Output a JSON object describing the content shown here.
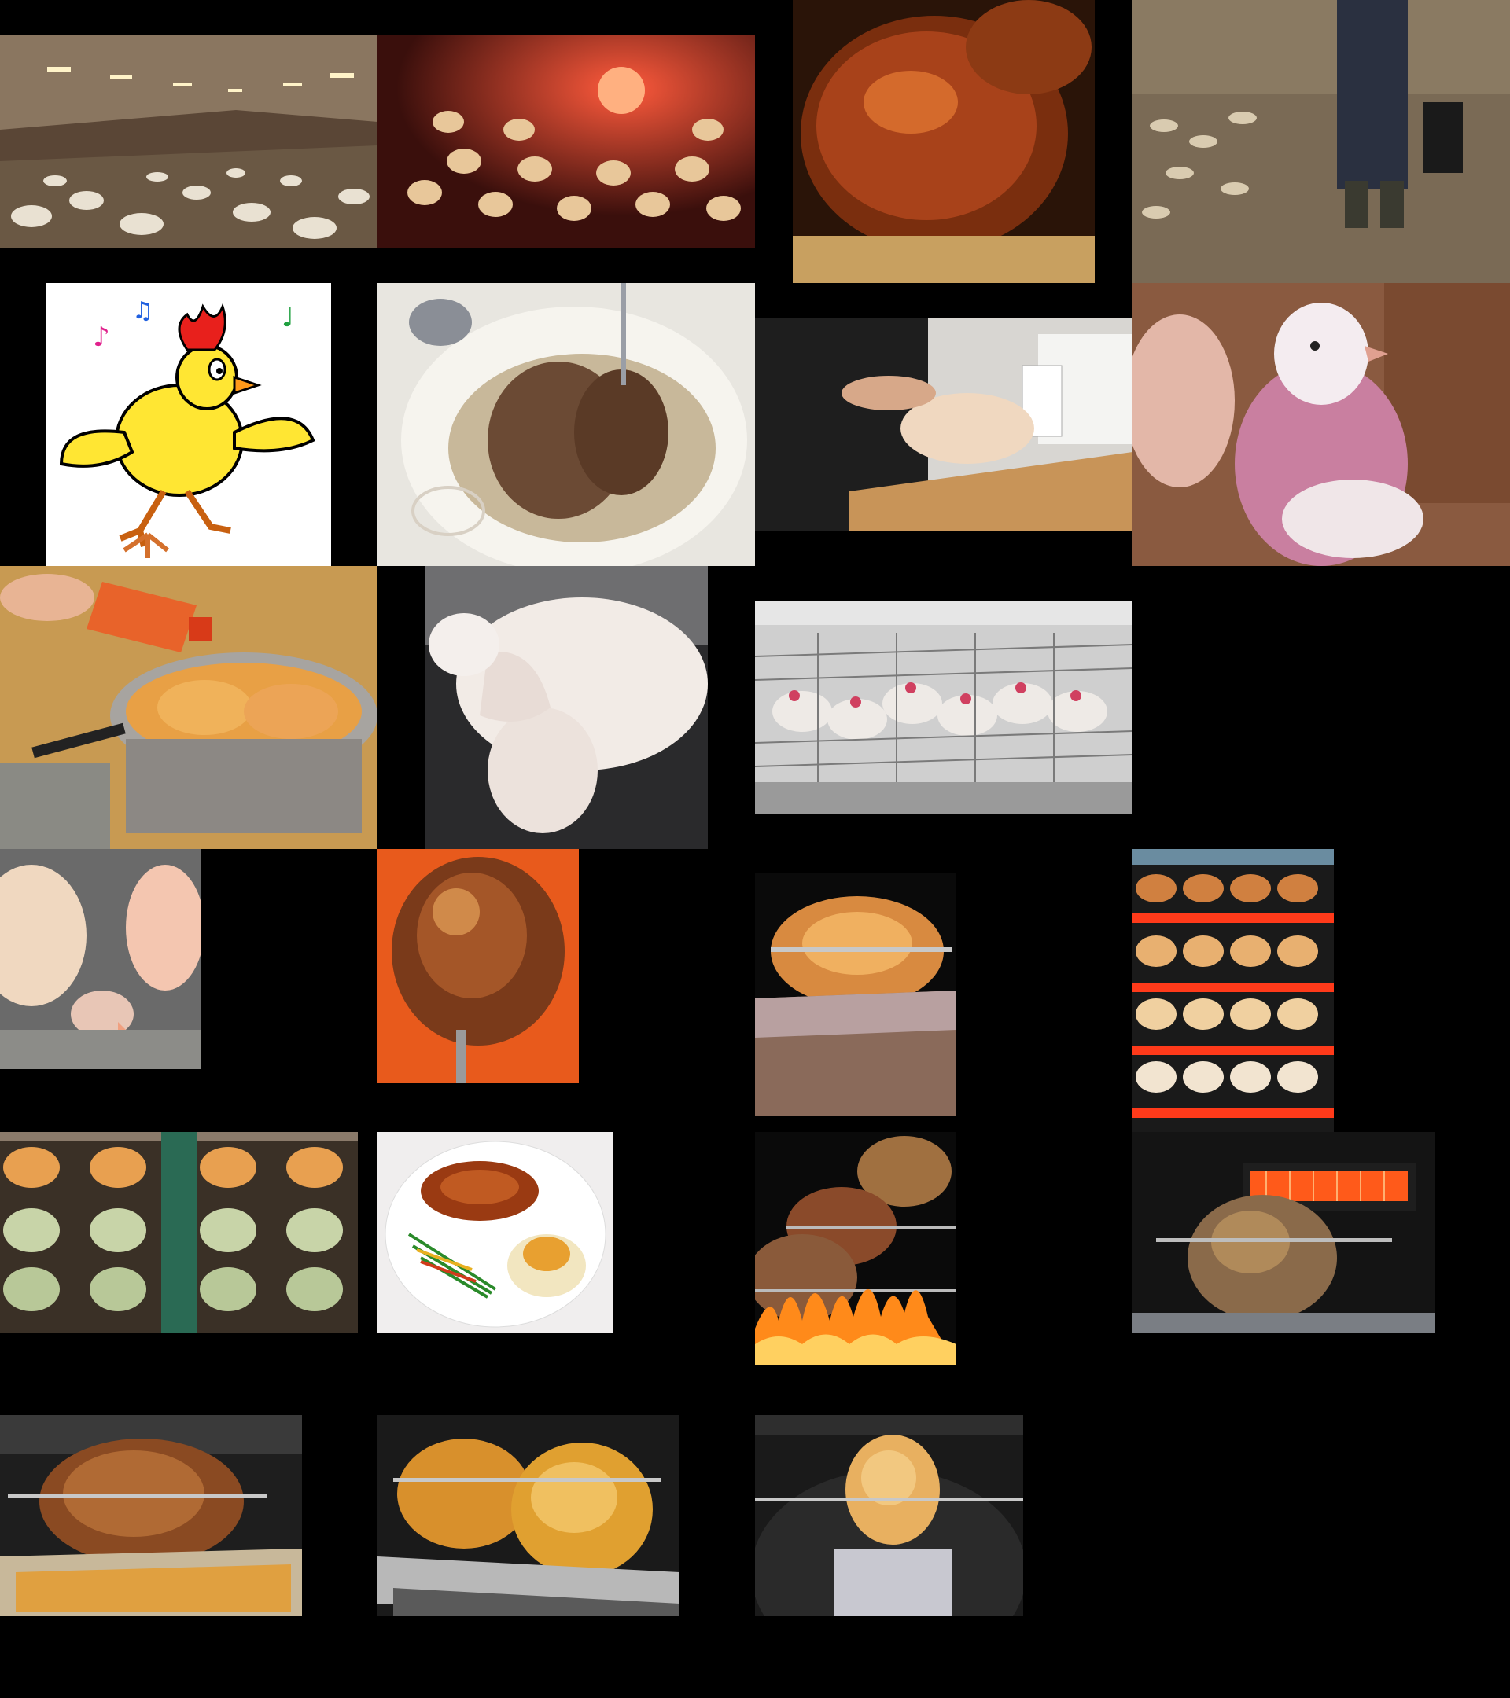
{
  "grid": {
    "background_color": "#000000",
    "tiles": [
      {
        "subject": "poultry-barn-photo"
      },
      {
        "subject": "chicks-under-heat-lamp-photo"
      },
      {
        "subject": "glazed-roast-chicken-photo"
      },
      {
        "subject": "farmer-in-broiler-house-photo"
      },
      {
        "subject": "dancing-chicken-cartoon"
      },
      {
        "subject": "braised-chicken-on-plate-photo"
      },
      {
        "subject": "preparing-raw-chicken-photo"
      },
      {
        "subject": "featherless-chicken-held-photo"
      },
      {
        "subject": "seasoning-chicken-in-pot-photo"
      },
      {
        "subject": "raw-whole-chicken-photo"
      },
      {
        "subject": "caged-hens-photo"
      },
      {
        "subject": "raw-chickens-on-tray-photo"
      },
      {
        "subject": "rotisserie-chicken-orange-backdrop-photo"
      },
      {
        "subject": "rotisserie-chicken-on-spit-photo"
      },
      {
        "subject": "rotisserie-oven-rows-photo"
      },
      {
        "subject": "rotisserie-display-rows-photo"
      },
      {
        "subject": "roast-chicken-dinner-plate-photo"
      },
      {
        "subject": "rotisserie-over-flames-photo"
      },
      {
        "subject": "gas-grill-rotisserie-photo"
      },
      {
        "subject": "grill-rotisserie-drip-pan-photo"
      },
      {
        "subject": "two-chickens-on-spit-photo"
      },
      {
        "subject": "kettle-grill-rotisserie-photo"
      }
    ]
  },
  "cartoon": {
    "music_notes": [
      "♪",
      "♫",
      "♩"
    ]
  }
}
